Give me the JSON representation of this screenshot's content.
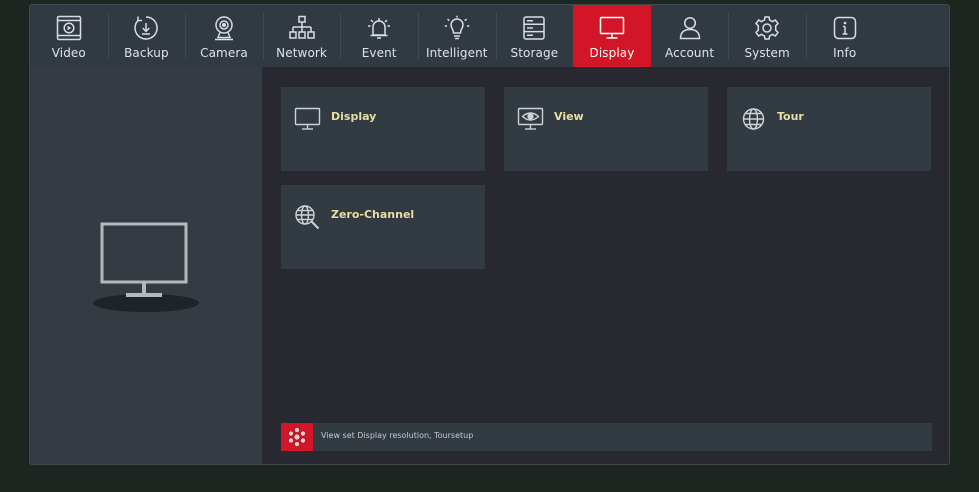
{
  "nav": {
    "items": [
      {
        "label": "Video",
        "icon": "video-icon"
      },
      {
        "label": "Backup",
        "icon": "backup-icon"
      },
      {
        "label": "Camera",
        "icon": "camera-icon"
      },
      {
        "label": "Network",
        "icon": "network-icon"
      },
      {
        "label": "Event",
        "icon": "event-alarm-icon"
      },
      {
        "label": "Intelligent",
        "icon": "intelligent-bulb-icon"
      },
      {
        "label": "Storage",
        "icon": "storage-icon"
      },
      {
        "label": "Display",
        "icon": "display-monitor-icon",
        "active": true
      },
      {
        "label": "Account",
        "icon": "account-user-icon"
      },
      {
        "label": "System",
        "icon": "system-gear-icon"
      },
      {
        "label": "Info",
        "icon": "info-icon"
      }
    ]
  },
  "sidebar": {
    "icon": "monitor-illustration-icon"
  },
  "tiles": [
    {
      "label": "Display",
      "icon": "monitor-icon"
    },
    {
      "label": "View",
      "icon": "view-eye-monitor-icon"
    },
    {
      "label": "Tour",
      "icon": "tour-globe-icon"
    },
    {
      "label": "Zero-Channel",
      "icon": "zero-channel-search-icon"
    }
  ],
  "hint": {
    "text": "View set Display resolution, Toursetup",
    "icon": "display-settings-icon"
  },
  "colors": {
    "accent": "#d21627",
    "tile_label": "#e7dfa6",
    "nav_bg": "#313a42",
    "content_bg": "#282930",
    "sidebar_bg": "#343b42",
    "tile_bg": "#323a42"
  }
}
